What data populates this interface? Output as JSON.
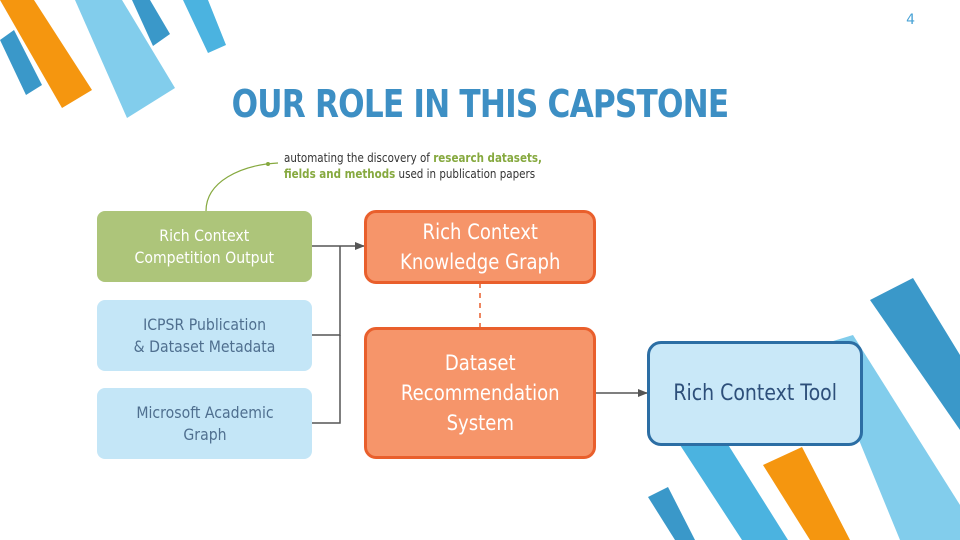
{
  "slide": {
    "page_number": "4",
    "title": "OUR ROLE IN THIS CAPSTONE"
  },
  "annotation": {
    "prefix": "automating the discovery of ",
    "highlight_1": "research datasets,",
    "highlight_2": "fields and methods",
    "suffix": " used in publication papers"
  },
  "sources": {
    "competition_output": "Rich Context\nCompetition Output",
    "icpsr_metadata": "ICPSR Publication\n& Dataset Metadata",
    "microsoft_graph": "Microsoft Academic\nGraph"
  },
  "nodes": {
    "knowledge_graph": "Rich Context\nKnowledge Graph",
    "recommendation_system": "Dataset\nRecommendation\nSystem",
    "tool": "Rich Context Tool"
  },
  "colors": {
    "title_blue": "#3d8fc4",
    "highlight_green": "#86a93f",
    "orange_fill": "#f6956a",
    "orange_border": "#e95f2c",
    "green_fill": "#adc57a",
    "light_blue_fill": "#c4e6f7",
    "tool_border": "#2c6ea4"
  }
}
